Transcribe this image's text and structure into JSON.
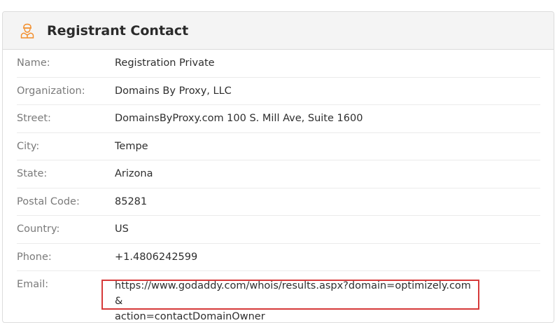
{
  "header": {
    "title": "Registrant Contact",
    "icon": "user-contact-icon",
    "accent_color": "#f28c28"
  },
  "rows": [
    {
      "label": "Name:",
      "value": "Registration Private"
    },
    {
      "label": "Organization:",
      "value": "Domains By Proxy, LLC"
    },
    {
      "label": "Street:",
      "value": "DomainsByProxy.com 100 S. Mill Ave, Suite 1600"
    },
    {
      "label": "City:",
      "value": "Tempe"
    },
    {
      "label": "State:",
      "value": "Arizona"
    },
    {
      "label": "Postal Code:",
      "value": "85281"
    },
    {
      "label": "Country:",
      "value": "US"
    },
    {
      "label": "Phone:",
      "value": "+1.4806242599"
    },
    {
      "label": "Email:",
      "value_line1": "https://www.godaddy.com/whois/results.aspx?domain=optimizely.com&",
      "value_line2": "action=contactDomainOwner"
    }
  ],
  "highlight_color": "#d63a3a"
}
